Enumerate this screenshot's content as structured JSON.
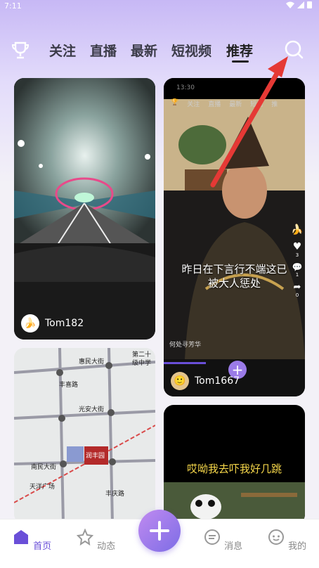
{
  "status": {
    "time": "7:11"
  },
  "topnav": {
    "tabs": [
      {
        "label": "关注"
      },
      {
        "label": "直播"
      },
      {
        "label": "最新"
      },
      {
        "label": "短视频"
      },
      {
        "label": "推荐"
      }
    ],
    "active_tab": "推荐"
  },
  "feed": {
    "cards": [
      {
        "author": "Tom182"
      },
      {
        "author": "Tom1667",
        "subtitle_line1": "昨日在下言行不端这已",
        "subtitle_line2": "被大人惩处",
        "watermark": "何处寻芳华",
        "like_count": "3",
        "comment_count": "1",
        "share_count": "0",
        "inner_time": "13:30",
        "inner_tabs": [
          "关注",
          "直播",
          "最新",
          "短视",
          "推"
        ]
      },
      {
        "map_labels": [
          "惠民大街",
          "丰喜路",
          "光安大街",
          "南民大街",
          "天洋广场",
          "润丰园",
          "第二十",
          "级中学",
          "丰庆路"
        ]
      },
      {
        "caption": "哎呦我去吓我好几跳"
      }
    ]
  },
  "bottomnav": {
    "items": [
      {
        "label": "首页"
      },
      {
        "label": "动态"
      },
      {
        "label": "消息"
      },
      {
        "label": "我的"
      }
    ],
    "active": "首页"
  },
  "colors": {
    "accent": "#6a4fd8",
    "arrow": "#e53935"
  }
}
